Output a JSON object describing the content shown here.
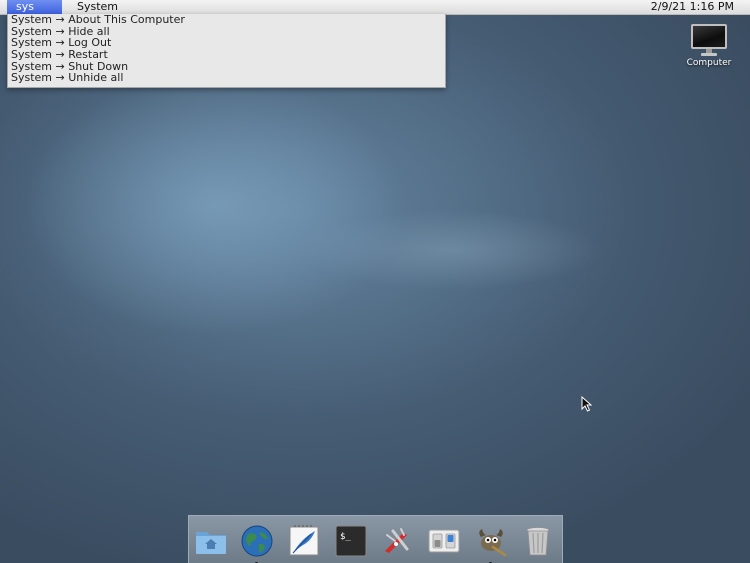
{
  "menubar": {
    "app_menu_label": "sys",
    "system_menu_label": "System",
    "clock": "2/9/21 1:16 PM"
  },
  "dropdown": {
    "items": [
      {
        "label": "System → About This Computer"
      },
      {
        "label": "System → Hide all"
      },
      {
        "label": "System → Log Out"
      },
      {
        "label": "System → Restart"
      },
      {
        "label": "System → Shut Down"
      },
      {
        "label": "System → Unhide all"
      }
    ]
  },
  "desktop": {
    "icons": [
      {
        "label": "Computer",
        "icon": "computer-monitor-icon"
      }
    ]
  },
  "dock": {
    "items": [
      {
        "icon": "home-folder-icon",
        "running": false
      },
      {
        "icon": "web-browser-globe-icon",
        "running": true
      },
      {
        "icon": "text-editor-quill-icon",
        "running": false
      },
      {
        "icon": "terminal-icon",
        "running": false
      },
      {
        "icon": "utilities-knife-icon",
        "running": false
      },
      {
        "icon": "settings-toggles-icon",
        "running": false
      },
      {
        "icon": "gimp-icon",
        "running": true
      },
      {
        "icon": "trash-icon",
        "running": false
      }
    ]
  },
  "colors": {
    "menu_highlight": "#4a6ee6",
    "desktop_background": "#465d74",
    "dock_background": "#7b8997"
  }
}
